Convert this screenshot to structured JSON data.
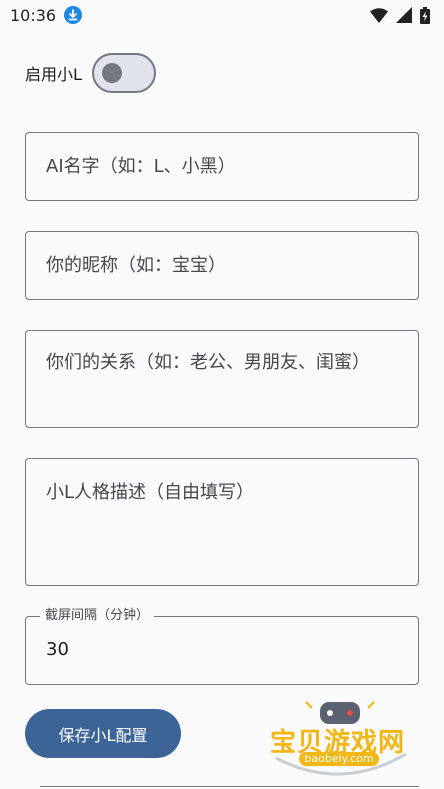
{
  "status_bar": {
    "time": "10:36",
    "icons": [
      "download-icon",
      "wifi-icon",
      "signal-icon",
      "battery-charging-icon"
    ]
  },
  "toggle": {
    "label": "启用小L",
    "state": "off"
  },
  "fields": {
    "ai_name_placeholder": "AI名字（如：L、小黑）",
    "nickname_placeholder": "你的昵称（如：宝宝）",
    "relationship_placeholder": "你们的关系（如：老公、男朋友、闺蜜）",
    "persona_placeholder": "小L人格描述（自由填写）",
    "interval_label": "截屏间隔（分钟）",
    "interval_value": "30"
  },
  "save_button": {
    "label": "保存小L配置"
  },
  "watermark": {
    "text": "宝贝游戏网",
    "sub": "baobeiy.com"
  },
  "colors": {
    "primary": "#3c6497",
    "outline": "#79747e",
    "watermark": "#f2b615"
  }
}
